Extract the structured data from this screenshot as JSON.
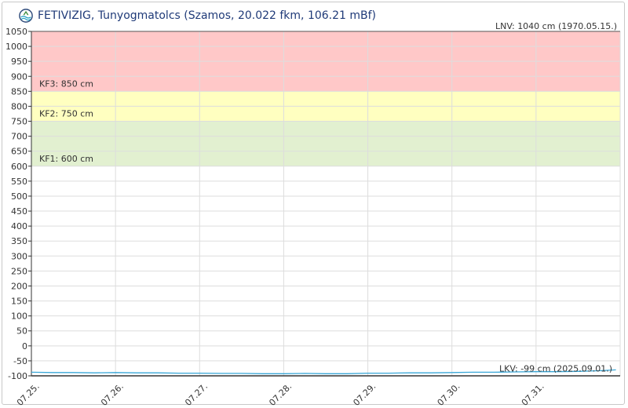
{
  "header": {
    "title": "FETIVIZIG, Tunyogmatolcs (Szamos, 20.022 fkm, 106.21 mBf)"
  },
  "chart_data": {
    "type": "line",
    "title": "FETIVIZIG, Tunyogmatolcs (Szamos, 20.022 fkm, 106.21 mBf)",
    "ylim": [
      -100,
      1050
    ],
    "yticks": [
      1050,
      1000,
      950,
      900,
      850,
      800,
      750,
      700,
      650,
      600,
      550,
      500,
      450,
      400,
      350,
      300,
      250,
      200,
      150,
      100,
      50,
      0,
      -50,
      -100
    ],
    "x_labels": [
      "07.25.",
      "07.26.",
      "07.27.",
      "07.28.",
      "07.29.",
      "07.30.",
      "07.31."
    ],
    "grid": true,
    "bands": [
      {
        "name": "KF3",
        "label": "KF3: 850 cm",
        "from": 850,
        "to": 1050,
        "color": "#ffc8c8"
      },
      {
        "name": "KF2",
        "label": "KF2: 750 cm",
        "from": 750,
        "to": 850,
        "color": "#ffffc0"
      },
      {
        "name": "KF1",
        "label": "KF1: 600 cm",
        "from": 600,
        "to": 750,
        "color": "#e2f0d0"
      }
    ],
    "annotations": {
      "lnv": {
        "label": "LNV: 1040 cm (1970.05.15.)",
        "value": 1040
      },
      "lkv": {
        "label": "LKV: -99 cm (2025.09.01.)",
        "value": -99
      }
    },
    "series": [
      {
        "color": "#3aa8d8",
        "x": [
          0,
          0.25,
          0.5,
          0.75,
          1,
          1.25,
          1.5,
          1.75,
          2,
          2.25,
          2.5,
          2.75,
          3,
          3.25,
          3.5,
          3.75,
          4,
          4.25,
          4.5,
          4.75,
          5,
          5.25,
          5.5,
          5.75,
          6,
          6.25,
          6.5,
          6.75,
          6.95
        ],
        "values": [
          -88,
          -89,
          -89,
          -90,
          -89,
          -90,
          -90,
          -91,
          -91,
          -92,
          -92,
          -93,
          -93,
          -92,
          -93,
          -93,
          -91,
          -91,
          -90,
          -90,
          -89,
          -88,
          -88,
          -87,
          -86,
          -86,
          -85,
          -83,
          -80
        ]
      }
    ]
  },
  "colors": {
    "grid": "#dddddd",
    "axis": "#333333",
    "tick_text": "#333333",
    "title": "#1f3a78",
    "line": "#3aa8d8"
  }
}
